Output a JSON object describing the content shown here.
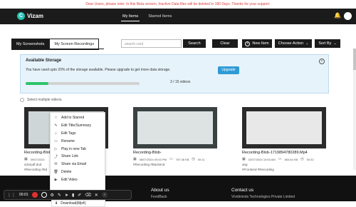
{
  "banner": "Dear Users, please note: In this Beta version, Inactive Data files will be deleted in 180 Days. Thanks for your support.",
  "app": {
    "logo_letter": "C",
    "name": "Vizam"
  },
  "nav": {
    "tabs": [
      "My Items",
      "Starred Items"
    ],
    "active": "My Items"
  },
  "content_tabs": [
    "My Screenshots",
    "My Screen Recordings"
  ],
  "search": {
    "placeholder": "search card",
    "button": "Search"
  },
  "toolbar": {
    "clear": "Clear",
    "new_item": "New Item",
    "choose_action": "Choose Action",
    "sort_by": "Sort By"
  },
  "storage": {
    "title": "Available Storage",
    "message": "You have used upto 20% of the storage available. Please upgrade to get more data storage.",
    "upgrade_label": "Upgrade",
    "usage_text": "3 / 15 videos",
    "fill_fraction": 0.2
  },
  "select_multiple": "Select multiple videos.",
  "cards": [
    {
      "title": "Recording-Blob-",
      "date": "09/07/2024",
      "size": "",
      "duration": "",
      "name_line": "sdvzpdf.dod",
      "tags": "#Recording #Ed"
    },
    {
      "title": "Recording-Blob-",
      "date": "08/07/2024 09:43 PM",
      "size": "767.08 KB",
      "duration": "00:11",
      "name_line": "",
      "tags": "#Recording #Backend"
    },
    {
      "title": "Recording-Blob-1719894780289.Mp4",
      "date": "02/07/2024 10:53 AM",
      "size": "563.64 KB",
      "duration": "00:32",
      "name_line": "ang",
      "tags": "#Frontend #Recording"
    }
  ],
  "context_menu": [
    {
      "icon": "star-icon",
      "glyph": "☆",
      "label": "Add to Starred"
    },
    {
      "icon": "edit-icon",
      "glyph": "✎",
      "label": "Edit Title/Summary"
    },
    {
      "icon": "tag-icon",
      "glyph": "⌂",
      "label": "Edit Tags"
    },
    {
      "icon": "rename-icon",
      "glyph": "▭",
      "label": "Rename"
    },
    {
      "icon": "play-icon",
      "glyph": "▷",
      "label": "Play in new Tab"
    },
    {
      "icon": "share-link-icon",
      "glyph": "⤴",
      "label": "Share Link"
    },
    {
      "icon": "email-icon",
      "glyph": "✉",
      "label": "Share via Email"
    },
    {
      "icon": "trash-icon",
      "glyph": "🗑",
      "label": "Delete"
    },
    {
      "icon": "video-icon",
      "glyph": "▶",
      "label": "Edit Video"
    }
  ],
  "download_item": "Download(Mp4)",
  "footer": {
    "about": "About us",
    "feedback": "FeedBack",
    "contact": "Contact us",
    "company": "Vividminds Technologies Private Limited"
  },
  "recorder": {
    "time": "00:01"
  }
}
